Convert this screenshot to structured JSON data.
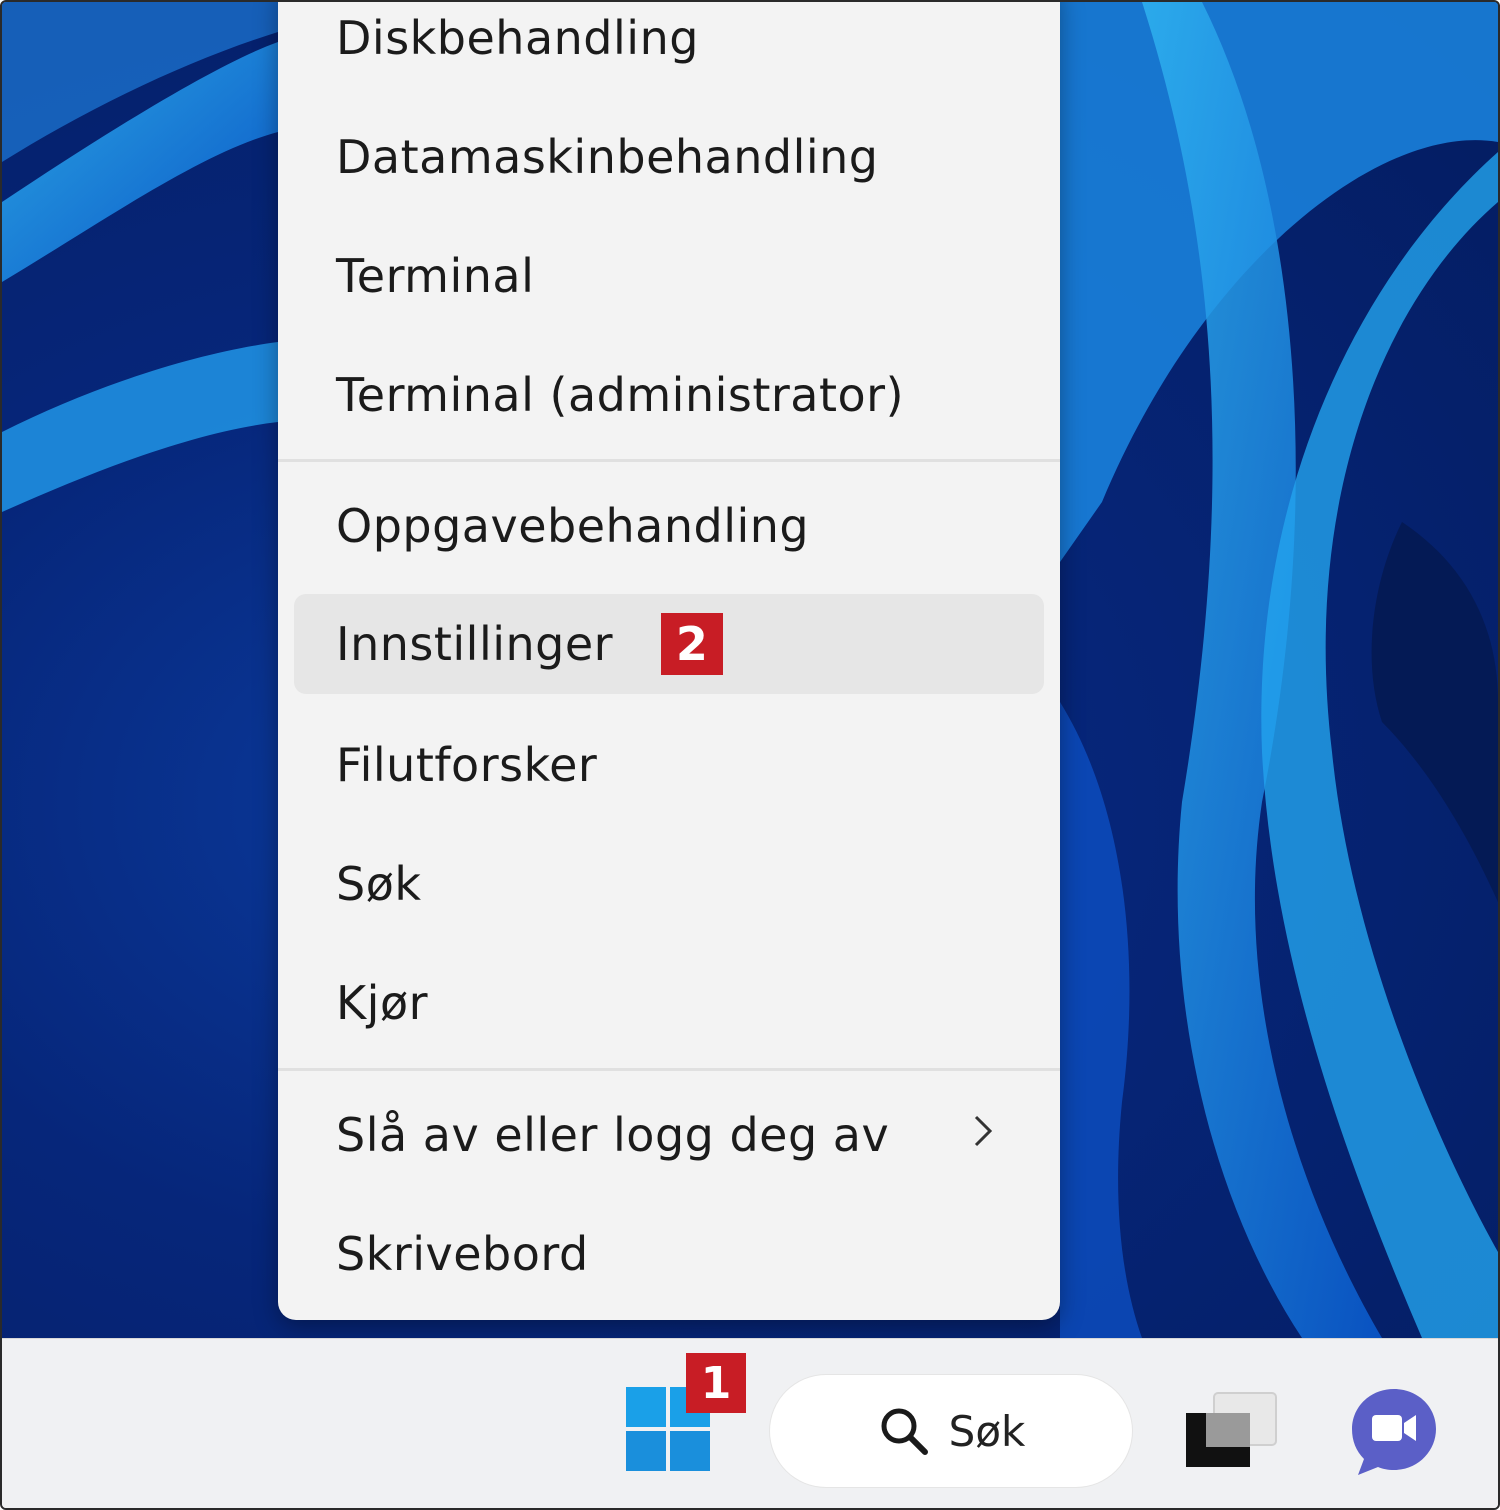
{
  "context_menu": {
    "items": [
      {
        "label": "Diskbehandling"
      },
      {
        "label": "Datamaskinbehandling"
      },
      {
        "label": "Terminal"
      },
      {
        "label": "Terminal (administrator)"
      },
      {
        "label": "Oppgavebehandling"
      },
      {
        "label": "Innstillinger",
        "badge": "2",
        "state": "hovered"
      },
      {
        "label": "Filutforsker"
      },
      {
        "label": "Søk"
      },
      {
        "label": "Kjør"
      },
      {
        "label": "Slå av eller logg deg av",
        "has_submenu": true
      },
      {
        "label": "Skrivebord"
      }
    ],
    "submenu_icon": "chevron-right-icon"
  },
  "taskbar": {
    "start_icon": "windows-logo-icon",
    "start_badge": "1",
    "search": {
      "label": "Søk",
      "icon": "search-icon"
    },
    "task_view_icon": "task-view-icon",
    "chat_icon": "chat-video-icon"
  },
  "colors": {
    "badge": "#c81d25",
    "menu_background": "#f3f3f3",
    "taskbar_background": "#f0f1f3",
    "wallpaper": "#06267a",
    "windows_logo": "#1aa0e8"
  }
}
